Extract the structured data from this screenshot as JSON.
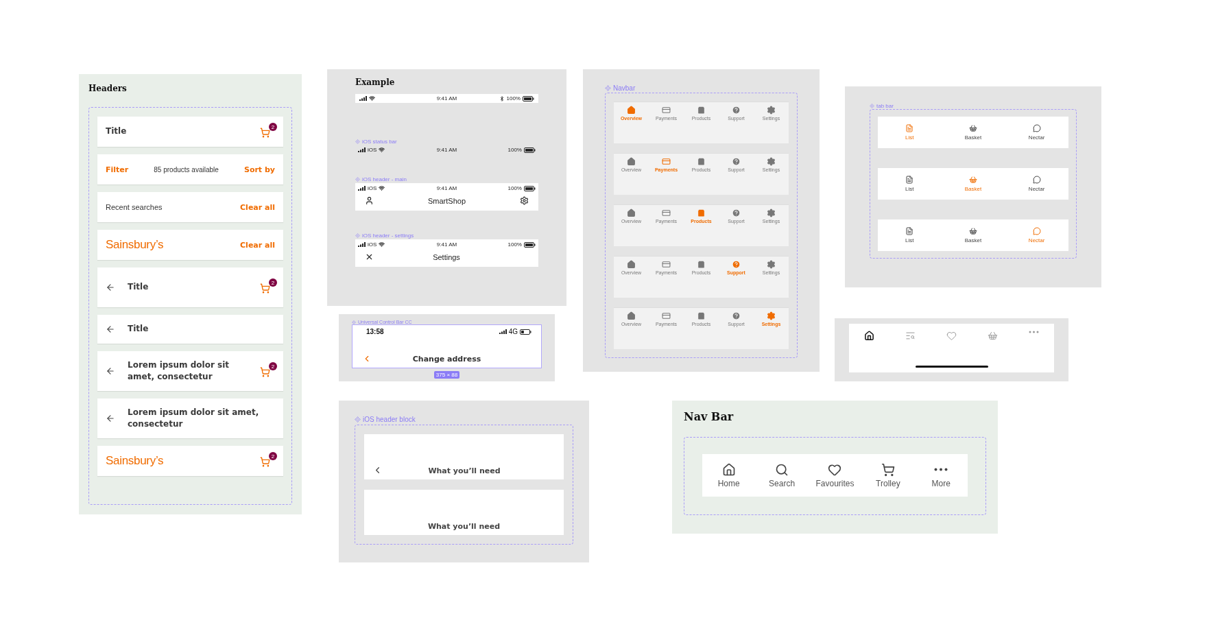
{
  "headers_frame": {
    "title": "Headers",
    "rows": [
      {
        "kind": "title",
        "title": "Title",
        "cart_badge": "2"
      },
      {
        "kind": "filter",
        "left": "Filter",
        "center": "85 products available",
        "right": "Sort by"
      },
      {
        "kind": "recent",
        "label": "Recent searches",
        "action": "Clear all"
      },
      {
        "kind": "logo",
        "logo": "Sainsbury’s",
        "action": "Clear all"
      },
      {
        "kind": "back",
        "title": "Title",
        "cart_badge": "2"
      },
      {
        "kind": "back",
        "title": "Title"
      },
      {
        "kind": "back",
        "title": "Lorem ipsum dolor sit amet, consectetur",
        "cart_badge": "2"
      },
      {
        "kind": "back",
        "title": "Lorem ipsum dolor sit amet, consectetur"
      },
      {
        "kind": "logo",
        "logo": "Sainsbury’s",
        "cart_badge": "2"
      }
    ]
  },
  "example_frame": {
    "title": "Example",
    "status_bar": {
      "time": "9:41 AM",
      "battery": "100%",
      "bluetooth": true
    },
    "components": [
      {
        "kind": "status",
        "label": "iOS status bar",
        "carrier": "iOS",
        "time": "9:41 AM",
        "battery": "100%"
      },
      {
        "kind": "main",
        "label": "iOS header - main",
        "carrier": "iOS",
        "time": "9:41 AM",
        "battery": "100%",
        "title": "SmartShop"
      },
      {
        "kind": "settings",
        "label": "iOS header - settings",
        "carrier": "iOS",
        "time": "9:41 AM",
        "battery": "100%",
        "title": "Settings"
      }
    ]
  },
  "universal_control_bar": {
    "label": "Universal Control Bar CC",
    "time": "13:58",
    "network": "4G",
    "title": "Change address",
    "size": "375 × 88"
  },
  "ios_header_block": {
    "label": "iOS header block",
    "headers": [
      {
        "title": "What you’ll need",
        "back": true
      },
      {
        "title": "What you’ll need",
        "back": false
      }
    ]
  },
  "navbar_frame": {
    "label": "Navbar",
    "bars": [
      {
        "items": [
          {
            "label": "Overview",
            "selected": true
          },
          {
            "label": "Payments",
            "selected": false
          },
          {
            "label": "Products",
            "selected": false
          },
          {
            "label": "Support",
            "selected": false
          },
          {
            "label": "Settings",
            "selected": false
          }
        ]
      },
      {
        "items": [
          {
            "label": "Overview",
            "selected": false
          },
          {
            "label": "Payments",
            "selected": true
          },
          {
            "label": "Products",
            "selected": false
          },
          {
            "label": "Support",
            "selected": false
          },
          {
            "label": "Settings",
            "selected": false
          }
        ]
      },
      {
        "items": [
          {
            "label": "Overview",
            "selected": false
          },
          {
            "label": "Payments",
            "selected": false
          },
          {
            "label": "Products",
            "selected": true
          },
          {
            "label": "Support",
            "selected": false
          },
          {
            "label": "Settings",
            "selected": false
          }
        ]
      },
      {
        "items": [
          {
            "label": "Overview",
            "selected": false
          },
          {
            "label": "Payments",
            "selected": false
          },
          {
            "label": "Products",
            "selected": false
          },
          {
            "label": "Support",
            "selected": true
          },
          {
            "label": "Settings",
            "selected": false
          }
        ]
      },
      {
        "items": [
          {
            "label": "Overview",
            "selected": false
          },
          {
            "label": "Payments",
            "selected": false
          },
          {
            "label": "Products",
            "selected": false
          },
          {
            "label": "Support",
            "selected": false
          },
          {
            "label": "Settings",
            "selected": true
          }
        ]
      }
    ]
  },
  "tab_bar_frame": {
    "label": "tab bar",
    "bars": [
      {
        "items": [
          {
            "label": "List",
            "selected": true
          },
          {
            "label": "Basket",
            "selected": false
          },
          {
            "label": "Nectar",
            "selected": false
          }
        ]
      },
      {
        "items": [
          {
            "label": "List",
            "selected": false
          },
          {
            "label": "Basket",
            "selected": true
          },
          {
            "label": "Nectar",
            "selected": false
          }
        ]
      },
      {
        "items": [
          {
            "label": "List",
            "selected": false
          },
          {
            "label": "Basket",
            "selected": false
          },
          {
            "label": "Nectar",
            "selected": true
          }
        ]
      }
    ]
  },
  "bottom_bar": {
    "items": [
      {
        "selected": true
      },
      {
        "selected": false
      },
      {
        "selected": false
      },
      {
        "selected": false
      },
      {
        "selected": false
      }
    ]
  },
  "nav_bar_frame": {
    "title": "Nav Bar",
    "items": [
      {
        "label": "Home"
      },
      {
        "label": "Search"
      },
      {
        "label": "Favourites"
      },
      {
        "label": "Trolley"
      },
      {
        "label": "More"
      }
    ]
  }
}
